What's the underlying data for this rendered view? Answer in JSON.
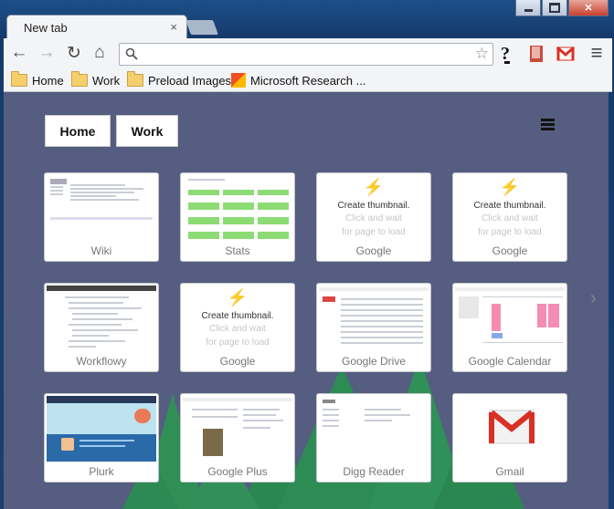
{
  "window": {
    "tab_title": "New tab",
    "tab_close": "×",
    "controls": {
      "close": "✕"
    }
  },
  "toolbar": {
    "back": "←",
    "forward": "→",
    "reload": "↻",
    "home": "⌂",
    "omnibox_value": "",
    "star": "☆",
    "menu": "≡"
  },
  "bookmarks": [
    {
      "label": "Home",
      "icon": "folder-icon"
    },
    {
      "label": "Work",
      "icon": "folder-icon"
    },
    {
      "label": "Preload Images",
      "icon": "folder-icon"
    },
    {
      "label": "Microsoft Research ...",
      "icon": "msr-icon"
    }
  ],
  "content": {
    "top_buttons": [
      "Home",
      "Work"
    ],
    "chevron": "›",
    "create": {
      "bolt": "⚡",
      "title": "Create thumbnail.",
      "hint1": "Click and wait",
      "hint2": "for page to load"
    },
    "tiles": [
      {
        "label": "Wiki",
        "thumb": "wiki"
      },
      {
        "label": "Stats",
        "thumb": "stats"
      },
      {
        "label": "Google",
        "thumb": "create"
      },
      {
        "label": "Google",
        "thumb": "create"
      },
      {
        "label": "Workflowy",
        "thumb": "doc"
      },
      {
        "label": "Google",
        "thumb": "create"
      },
      {
        "label": "Google Drive",
        "thumb": "drive"
      },
      {
        "label": "Google Calendar",
        "thumb": "calendar"
      },
      {
        "label": "Plurk",
        "thumb": "plurk"
      },
      {
        "label": "Google Plus",
        "thumb": "gplus"
      },
      {
        "label": "Digg Reader",
        "thumb": "digg"
      },
      {
        "label": "Gmail",
        "thumb": "gmail"
      }
    ]
  },
  "colors": {
    "background": "#555d80",
    "tree": "#2e8b57",
    "gmail_red": "#d93025"
  }
}
